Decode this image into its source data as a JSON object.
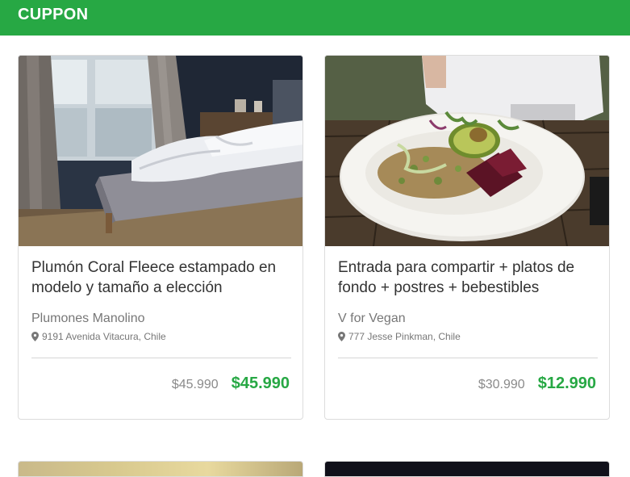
{
  "header": {
    "brand": "CUPPON",
    "accent_color": "#27a844"
  },
  "cards": [
    {
      "title": "Plumón Coral Fleece estampado en modelo y tamaño a elección",
      "merchant": "Plumones Manolino",
      "address": "9191 Avenida Vitacura, Chile",
      "old_price": "$45.990",
      "new_price": "$45.990",
      "image_icon": "bedroom-photo"
    },
    {
      "title": "Entrada para compartir + platos de fondo + postres + bebestibles",
      "merchant": "V for Vegan",
      "address": "777 Jesse Pinkman, Chile",
      "old_price": "$30.990",
      "new_price": "$12.990",
      "image_icon": "vegan-dish-photo"
    }
  ]
}
